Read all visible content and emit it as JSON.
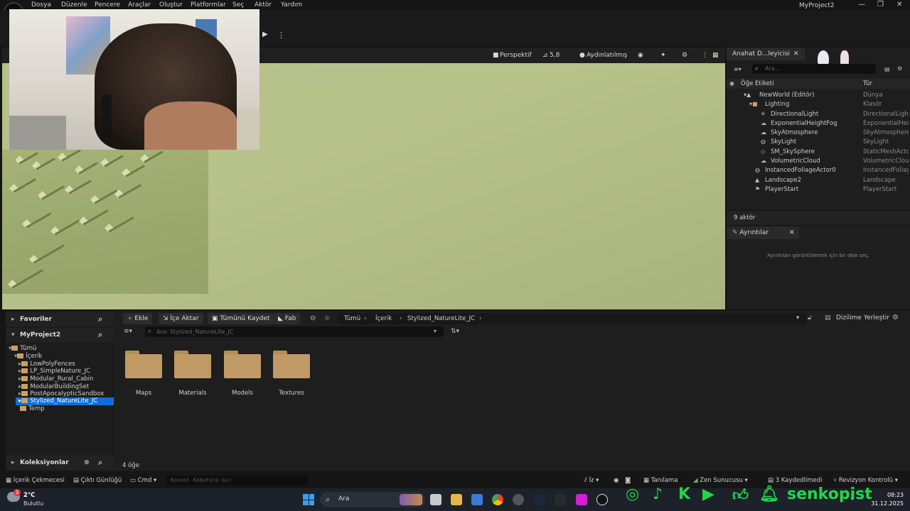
{
  "menu": [
    "Dosya",
    "Düzenle",
    "Pencere",
    "Araçlar",
    "Oluştur",
    "Platformlar",
    "Seç",
    "Aktör",
    "Yardım"
  ],
  "window": {
    "title": "MyProject2",
    "minimize": "—",
    "maximize": "❐",
    "close": "✕"
  },
  "viewport": {
    "perspective": "Perspektif",
    "fov": "5,8",
    "lighting": "Aydınlatılmış"
  },
  "outliner": {
    "tab": "Anahat D...leyicisi",
    "search_placeholder": "Ara...",
    "col_label": "Öğe Etiketi",
    "col_type": "Tür",
    "rows": [
      {
        "name": "NewWorld (Editör)",
        "type": "Dünya"
      },
      {
        "name": "Lighting",
        "type": "Klasör"
      },
      {
        "name": "DirectionalLight",
        "type": "DirectionalLight"
      },
      {
        "name": "ExponentialHeightFog",
        "type": "ExponentialHeigh"
      },
      {
        "name": "SkyAtmosphere",
        "type": "SkyAtmosphere"
      },
      {
        "name": "SkyLight",
        "type": "SkyLight"
      },
      {
        "name": "SM_SkySphere",
        "type": "StaticMeshActor"
      },
      {
        "name": "VolumetricCloud",
        "type": "VolumetricCloud"
      },
      {
        "name": "InstancedFoliageActor0",
        "type": "InstancedFoliage"
      },
      {
        "name": "Landscape2",
        "type": "Landscape"
      },
      {
        "name": "PlayerStart",
        "type": "PlayerStart"
      }
    ],
    "count": "9 aktör"
  },
  "details": {
    "tab": "Ayrıntılar",
    "empty_msg": "Ayrıntıları görüntülemek için bir obje seç."
  },
  "content_browser": {
    "favorites": "Favoriler",
    "project": "MyProject2",
    "collections": "Koleksiyonlar",
    "tree": [
      "Tümü",
      "İçerik",
      "LowPolyFences",
      "LP_SimpleNature_JC",
      "Modular_Rural_Cabin",
      "ModularBuildingSet",
      "PostApocalypticSandbox",
      "Stylized_NatureLite_JC",
      "Temp"
    ],
    "buttons": {
      "add": "Ekle",
      "import": "İçe Aktar",
      "save_all": "Tümünü Kaydet",
      "fab": "Fab"
    },
    "breadcrumb": [
      "Tümü",
      "İçerik",
      "Stylized_NatureLite_JC"
    ],
    "search_placeholder": "Ara: Stylized_NatureLite_JC",
    "dock": "Dizilime Yerleştir",
    "folders": [
      "Maps",
      "Materials",
      "Models",
      "Textures"
    ],
    "item_count": "4 öğe"
  },
  "statusbar": {
    "drawer": "İçerik Çekmecesi",
    "log": "Çıktı Günlüğü",
    "cmd": "Cmd",
    "console_placeholder": "Konsol Komutunu Gir",
    "trace": "Tanılama",
    "zen": "Zen Sunucusu",
    "saved": "3 Kaydedilmedi",
    "revision": "Revizyon Kontrolü",
    "iz": "İz"
  },
  "taskbar": {
    "weather_temp": "2°C",
    "weather_desc": "Bulutlu",
    "search": "Ara",
    "time": "08:23",
    "date": "31.12.2025",
    "badge": "3"
  },
  "overlay": {
    "brand": "senkopist"
  },
  "colors": {
    "accent_selected": "#0f6fd8",
    "folder": "#c09a64",
    "social_green": "#22d64a"
  }
}
